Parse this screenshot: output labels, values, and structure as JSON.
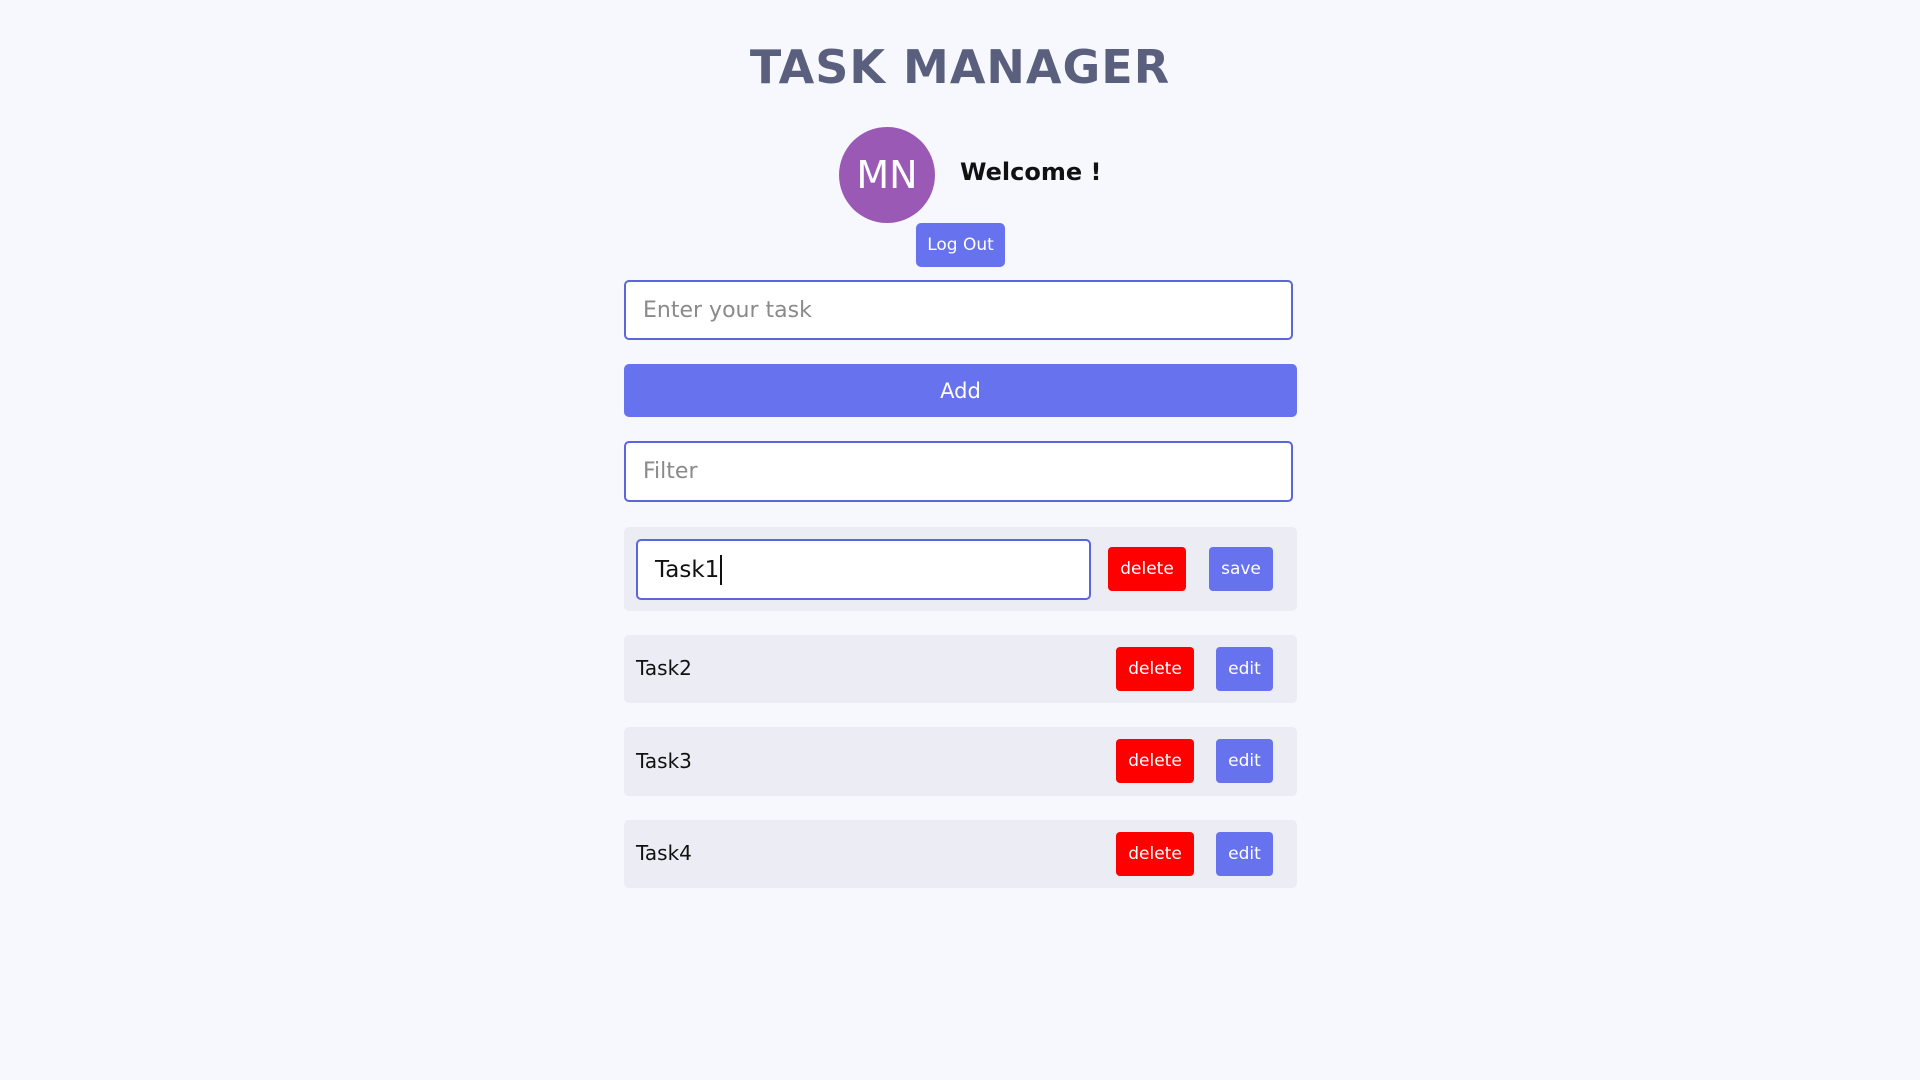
{
  "app": {
    "title": "TASK MANAGER"
  },
  "user": {
    "initials": "MN",
    "welcome": "Welcome !",
    "logout_label": "Log Out"
  },
  "form": {
    "task_placeholder": "Enter your task",
    "add_label": "Add",
    "filter_placeholder": "Filter"
  },
  "tasks": [
    {
      "text": "Task1",
      "editing": true,
      "delete_label": "delete",
      "action_label": "save"
    },
    {
      "text": "Task2",
      "editing": false,
      "delete_label": "delete",
      "action_label": "edit"
    },
    {
      "text": "Task3",
      "editing": false,
      "delete_label": "delete",
      "action_label": "edit"
    },
    {
      "text": "Task4",
      "editing": false,
      "delete_label": "delete",
      "action_label": "edit"
    }
  ],
  "colors": {
    "background": "#f7f8fd",
    "title": "#5b5f7e",
    "avatar": "#9b59b6",
    "primary": "#6672ee",
    "danger": "#ff0000",
    "card": "#ececf4",
    "input_border": "#5b66d9"
  }
}
